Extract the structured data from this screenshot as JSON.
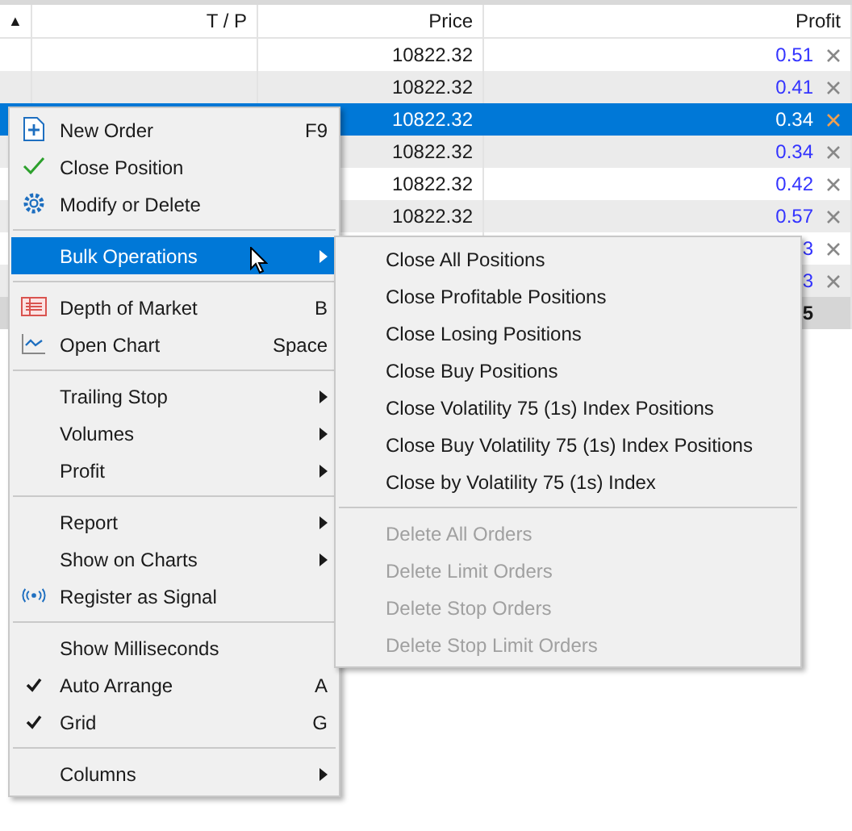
{
  "table": {
    "columns": [
      {
        "label": "▲"
      },
      {
        "label": "T / P"
      },
      {
        "label": "Price"
      },
      {
        "label": "Profit"
      }
    ],
    "rows": [
      {
        "price": "10822.32",
        "profit": "0.51",
        "selected": false
      },
      {
        "price": "10822.32",
        "profit": "0.41",
        "selected": false
      },
      {
        "price": "10822.32",
        "profit": "0.34",
        "selected": true
      },
      {
        "price": "10822.32",
        "profit": "0.34",
        "selected": false
      },
      {
        "price": "10822.32",
        "profit": "0.42",
        "selected": false
      },
      {
        "price": "10822.32",
        "profit": "0.57",
        "selected": false
      },
      {
        "profit": "3",
        "selected": false
      },
      {
        "profit": "3",
        "selected": false
      }
    ],
    "summary": {
      "profit": "5"
    }
  },
  "context_menu": {
    "sections": [
      {
        "items": [
          {
            "label": "New Order",
            "shortcut": "F9",
            "kind": "action",
            "highlighted": false
          },
          {
            "label": "Close Position",
            "kind": "action",
            "highlighted": false
          },
          {
            "label": "Modify or Delete",
            "kind": "action",
            "highlighted": false
          }
        ]
      },
      {
        "items": [
          {
            "label": "Bulk Operations",
            "kind": "submenu",
            "highlighted": true
          }
        ]
      },
      {
        "items": [
          {
            "label": "Depth of Market",
            "shortcut": "B",
            "kind": "action",
            "highlighted": false
          },
          {
            "label": "Open Chart",
            "shortcut": "Space",
            "kind": "action",
            "highlighted": false
          }
        ]
      },
      {
        "items": [
          {
            "label": "Trailing Stop",
            "kind": "submenu",
            "highlighted": false
          },
          {
            "label": "Volumes",
            "kind": "submenu",
            "highlighted": false
          },
          {
            "label": "Profit",
            "kind": "submenu",
            "highlighted": false
          }
        ]
      },
      {
        "items": [
          {
            "label": "Report",
            "kind": "submenu",
            "highlighted": false
          },
          {
            "label": "Show on Charts",
            "kind": "submenu",
            "highlighted": false
          },
          {
            "label": "Register as Signal",
            "kind": "action",
            "highlighted": false
          }
        ]
      },
      {
        "items": [
          {
            "label": "Show Milliseconds",
            "kind": "toggle",
            "checked": false,
            "highlighted": false
          },
          {
            "label": "Auto Arrange",
            "shortcut": "A",
            "kind": "toggle",
            "checked": true,
            "highlighted": false
          },
          {
            "label": "Grid",
            "shortcut": "G",
            "kind": "toggle",
            "checked": true,
            "highlighted": false
          }
        ]
      },
      {
        "items": [
          {
            "label": "Columns",
            "kind": "submenu",
            "highlighted": false
          }
        ]
      }
    ]
  },
  "submenu": {
    "sections": [
      {
        "items": [
          {
            "label": "Close All Positions",
            "disabled": false
          },
          {
            "label": "Close Profitable Positions",
            "disabled": false
          },
          {
            "label": "Close Losing Positions",
            "disabled": false
          },
          {
            "label": "Close Buy Positions",
            "disabled": false
          },
          {
            "label": "Close Volatility 75 (1s) Index Positions",
            "disabled": false
          },
          {
            "label": "Close Buy Volatility 75 (1s) Index Positions",
            "disabled": false
          },
          {
            "label": "Close by Volatility 75 (1s) Index",
            "disabled": false
          }
        ]
      },
      {
        "items": [
          {
            "label": "Delete All Orders",
            "disabled": true
          },
          {
            "label": "Delete Limit Orders",
            "disabled": true
          },
          {
            "label": "Delete Stop Orders",
            "disabled": true
          },
          {
            "label": "Delete Stop Limit Orders",
            "disabled": true
          }
        ]
      }
    ]
  }
}
